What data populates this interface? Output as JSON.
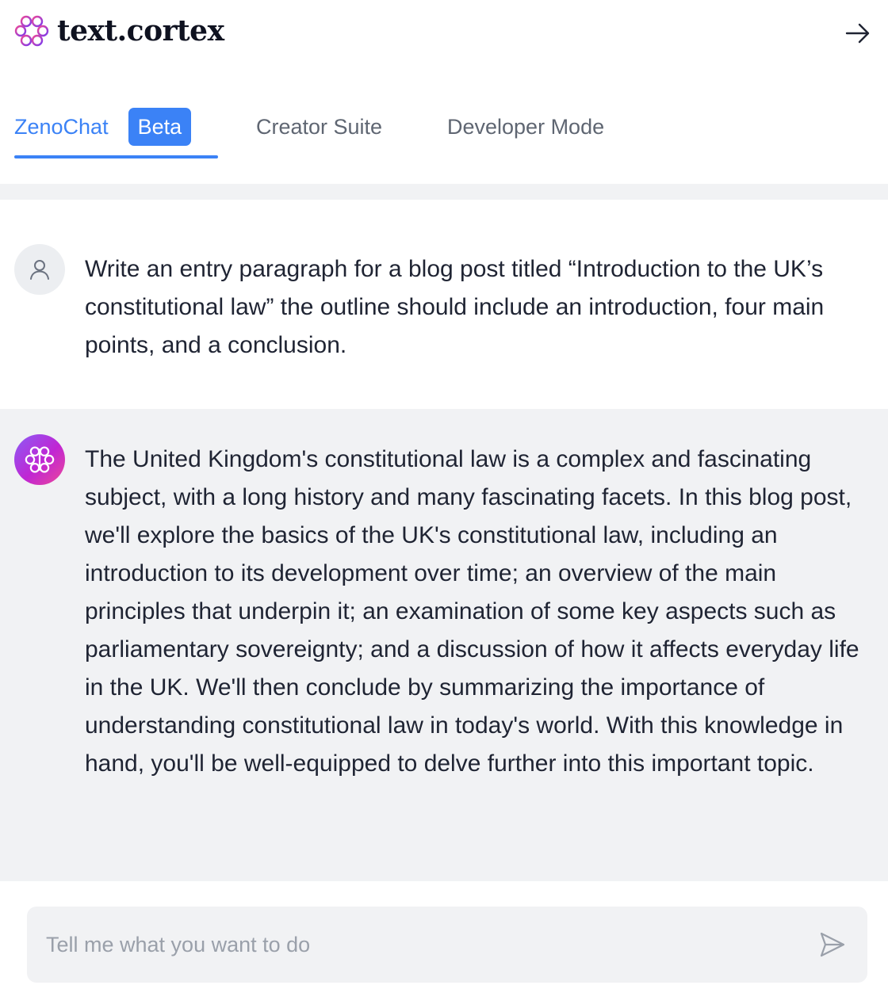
{
  "header": {
    "brand": "text.cortex",
    "logo_icon": "brain-icon",
    "collapse_icon": "arrow-right-icon"
  },
  "tabs": [
    {
      "label": "ZenoChat",
      "badge": "Beta",
      "active": true
    },
    {
      "label": "Creator Suite",
      "active": false
    },
    {
      "label": "Developer Mode",
      "active": false
    }
  ],
  "conversation": [
    {
      "role": "user",
      "avatar_icon": "user-icon",
      "text": "Write an entry paragraph for a blog post titled “Introduction to the UK’s constitutional law” the outline should include an introduction, four main points, and a conclusion."
    },
    {
      "role": "assistant",
      "avatar_icon": "brain-icon",
      "text": "The United Kingdom's constitutional law is a complex and fascinating subject, with a long history and many fascinating facets. In this blog post, we'll explore the basics of the UK's constitutional law, including an introduction to its development over time; an overview of the main principles that underpin it; an examination of some key aspects such as parliamentary sovereignty; and a discussion of how it affects everyday life in the UK. We'll then conclude by summarizing the importance of understanding constitutional law in today's world. With this knowledge in hand, you'll be well-equipped to delve further into this important topic."
    }
  ],
  "composer": {
    "placeholder": "Tell me what you want to do",
    "value": "",
    "send_icon": "send-icon"
  },
  "colors": {
    "accent": "#3b82f6",
    "bot_avatar_gradient": [
      "#8b5cf6",
      "#ec4899"
    ],
    "logo": "#a855f7"
  }
}
